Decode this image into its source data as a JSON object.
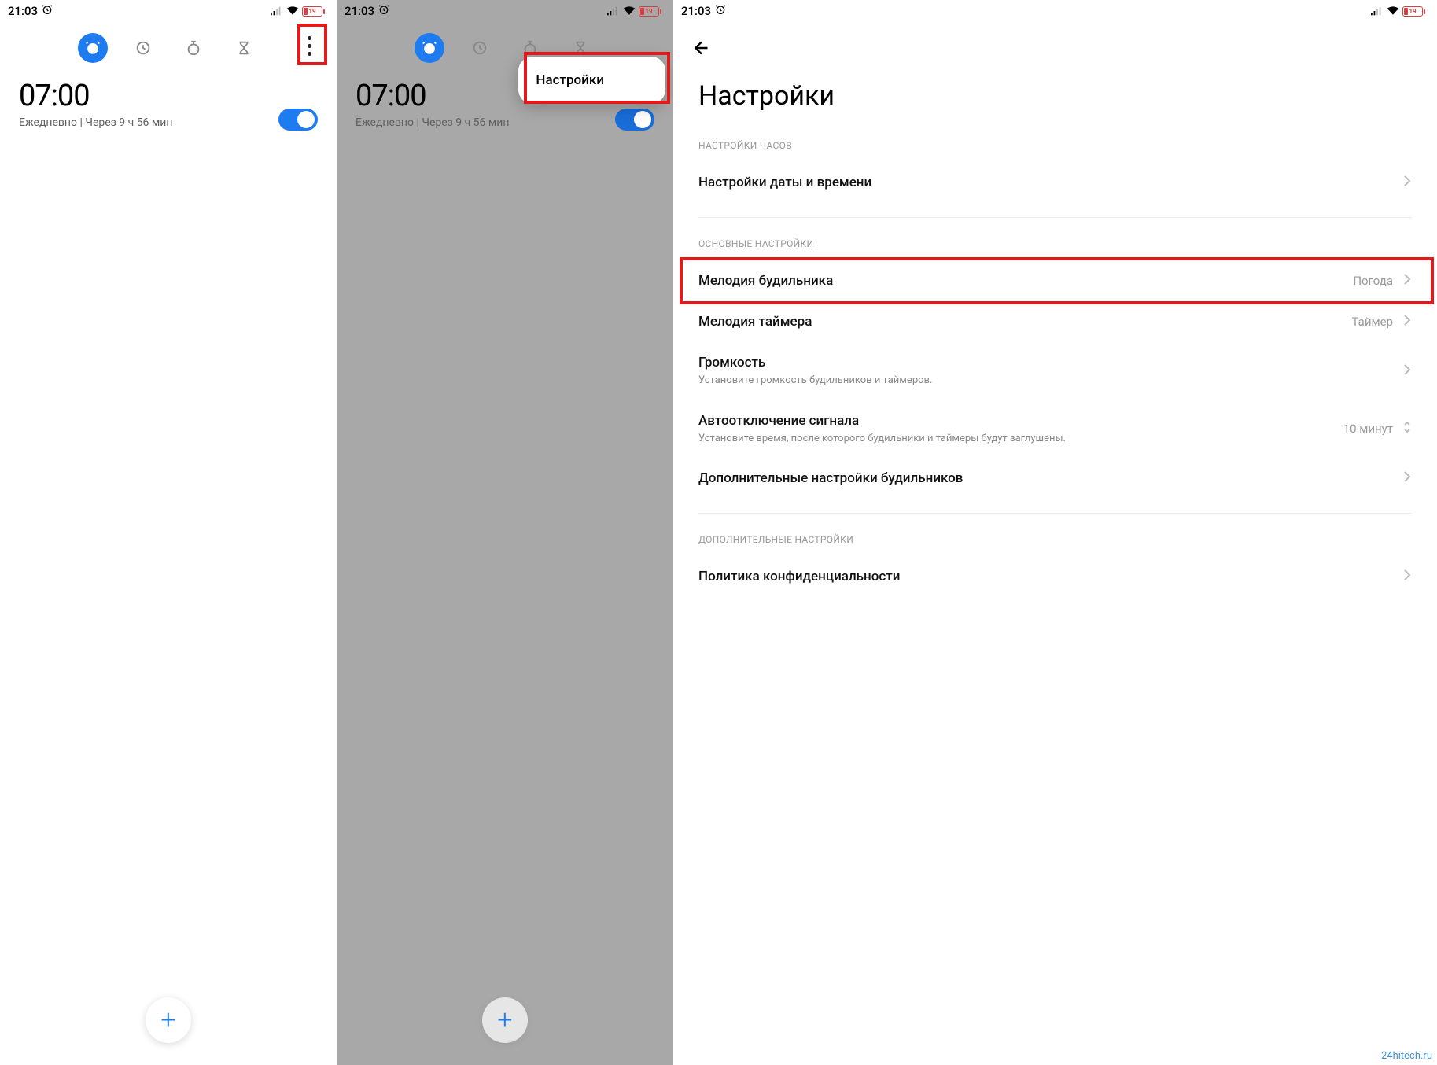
{
  "status": {
    "time": "21:03",
    "battery": "19"
  },
  "tabs": {
    "alarm": "alarm",
    "clock": "clock",
    "stopwatch": "stopwatch",
    "timer": "timer"
  },
  "alarm": {
    "time": "07:00",
    "repeat": "Ежедневно",
    "sep": "  |  ",
    "countdown": "Через 9 ч 56 мин"
  },
  "popup": {
    "settings": "Настройки"
  },
  "settings": {
    "title": "Настройки",
    "section_clock": "НАСТРОЙКИ ЧАСОВ",
    "datetime": "Настройки даты и времени",
    "section_main": "ОСНОВНЫЕ НАСТРОЙКИ",
    "alarm_sound": "Мелодия будильника",
    "alarm_sound_val": "Погода",
    "timer_sound": "Мелодия таймера",
    "timer_sound_val": "Таймер",
    "volume": "Громкость",
    "volume_sub": "Установите громкость будильников и таймеров.",
    "auto_off": "Автоотключение сигнала",
    "auto_off_sub": "Установите время, после которого будильники и таймеры будут заглушены.",
    "auto_off_val": "10 минут",
    "adv_alarm": "Дополнительные настройки будильников",
    "section_extra": "ДОПОЛНИТЕЛЬНЫЕ НАСТРОЙКИ",
    "privacy": "Политика конфиденциальности"
  },
  "watermark": "24hitech.ru"
}
